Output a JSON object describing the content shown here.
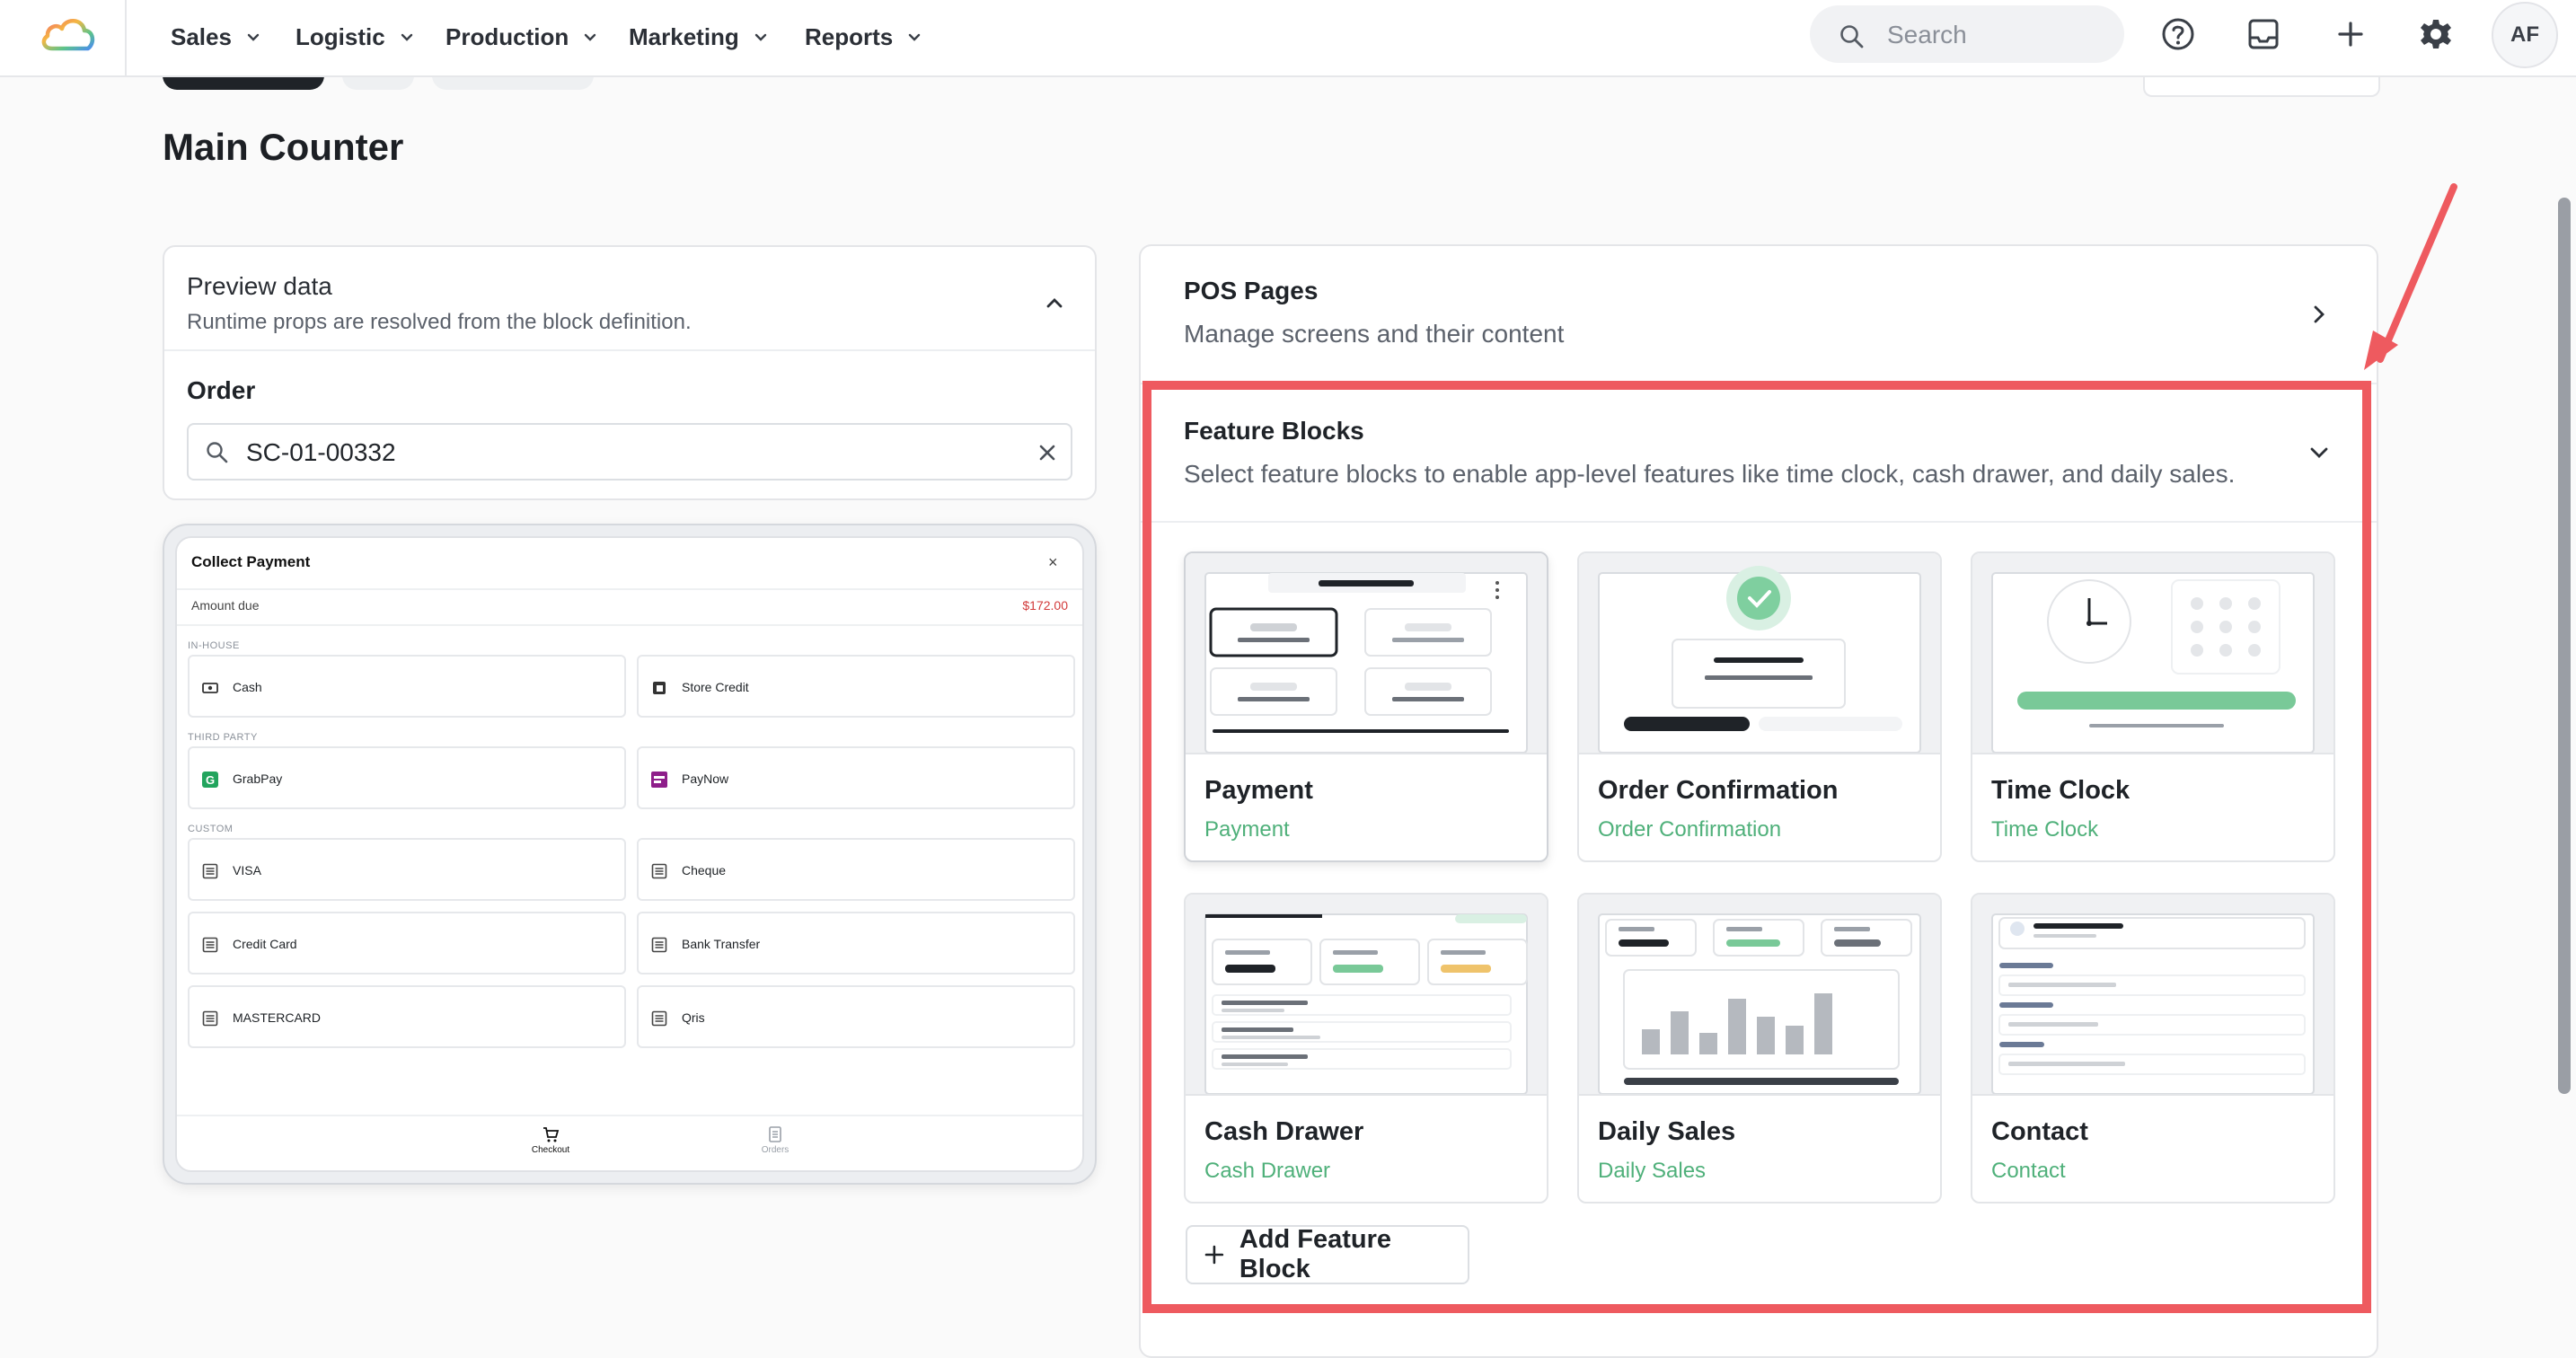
{
  "nav": {
    "items": [
      {
        "label": "Sales"
      },
      {
        "label": "Logistic"
      },
      {
        "label": "Production"
      },
      {
        "label": "Marketing"
      },
      {
        "label": "Reports"
      }
    ],
    "search_placeholder": "Search",
    "avatar_initials": "AF"
  },
  "page": {
    "title": "Main Counter"
  },
  "preview": {
    "title": "Preview data",
    "subtitle": "Runtime props are resolved from the block definition.",
    "order_label": "Order",
    "order_value": "SC-01-00332"
  },
  "payment_screen": {
    "title": "Collect Payment",
    "amount_label": "Amount due",
    "amount_value": "$172.00",
    "sections": {
      "in_house": "IN-HOUSE",
      "third_party": "THIRD PARTY",
      "custom": "CUSTOM"
    },
    "methods": {
      "cash": "Cash",
      "store_credit": "Store Credit",
      "grabpay": "GrabPay",
      "paynow": "PayNow",
      "visa": "VISA",
      "cheque": "Cheque",
      "credit_card": "Credit Card",
      "bank_transfer": "Bank Transfer",
      "mastercard": "MASTERCARD",
      "qris": "Qris"
    },
    "tabs": {
      "checkout": "Checkout",
      "orders": "Orders"
    }
  },
  "pos_pages": {
    "title": "POS Pages",
    "subtitle": "Manage screens and their content"
  },
  "feature_blocks": {
    "title": "Feature Blocks",
    "subtitle": "Select feature blocks to enable app-level features like time clock, cash drawer, and daily sales.",
    "cards": [
      {
        "name": "Payment",
        "type": "Payment"
      },
      {
        "name": "Order Confirmation",
        "type": "Order Confirmation"
      },
      {
        "name": "Time Clock",
        "type": "Time Clock"
      },
      {
        "name": "Cash Drawer",
        "type": "Cash Drawer"
      },
      {
        "name": "Daily Sales",
        "type": "Daily Sales"
      },
      {
        "name": "Contact",
        "type": "Contact"
      }
    ],
    "add_label": "Add Feature Block"
  },
  "colors": {
    "accent_green": "#4fb07a",
    "highlight_red": "#ee5a5f",
    "amount_red": "#d23b3b"
  }
}
